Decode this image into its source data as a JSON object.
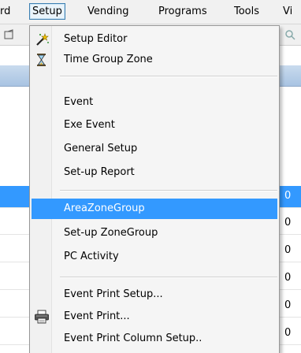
{
  "menubar": {
    "items": [
      {
        "label": "rd"
      },
      {
        "label": "Setup",
        "active": true
      },
      {
        "label": "Vending"
      },
      {
        "label": "Programs"
      },
      {
        "label": "Tools"
      },
      {
        "label": "Vi"
      }
    ]
  },
  "grid": {
    "rows": [
      {
        "value": "0",
        "selected": true
      },
      {
        "value": "0"
      },
      {
        "value": "0"
      },
      {
        "value": "0"
      },
      {
        "value": "0"
      },
      {
        "value": "0"
      }
    ]
  },
  "dropdown": {
    "items": [
      {
        "label": "Setup Editor",
        "icon": "wand-icon"
      },
      {
        "label": "Time Group Zone",
        "icon": "hourglass-icon"
      },
      {
        "label": "Event"
      },
      {
        "label": "Exe Event"
      },
      {
        "label": "General Setup"
      },
      {
        "label": "Set-up Report"
      },
      {
        "label": "AreaZoneGroup",
        "highlighted": true
      },
      {
        "label": "Set-up ZoneGroup"
      },
      {
        "label": "PC Activity"
      },
      {
        "label": "Event Print Setup..."
      },
      {
        "label": "Event Print...",
        "icon": "printer-icon"
      },
      {
        "label": "Event Print Column Setup.."
      }
    ]
  },
  "colors": {
    "highlight": "#3399ff",
    "menu_background": "#f5f5f5",
    "active_menu_border": "#3c7fb1"
  }
}
